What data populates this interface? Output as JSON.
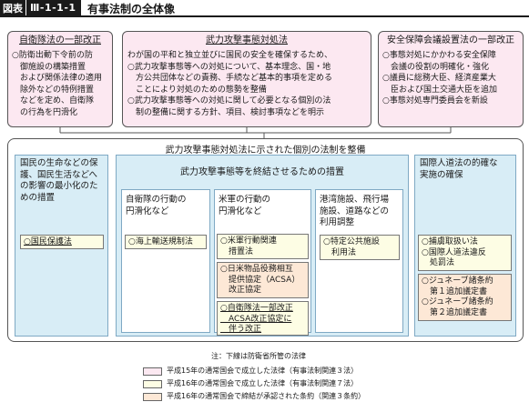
{
  "header": {
    "tag": "図表",
    "number": "Ⅲ-1-1-1",
    "title": "有事法制の全体像"
  },
  "top_boxes": [
    {
      "title": "自衛隊法の一部改正",
      "lines": [
        "○防衛出動下令前の防",
        "　御施設の構築措置",
        "　および関係法律の適用",
        "　除外などの特例措置",
        "　などを定め、自衛隊",
        "　の行為を円滑化"
      ]
    },
    {
      "title": "武力攻撃事態対処法",
      "lines": [
        "わが国の平和と独立並びに国民の安全を確保するため、",
        "○武力攻撃事態等への対処について、基本理念、国・地",
        "　方公共団体などの責務、手続など基本的事項を定める",
        "　ことにより対処のための態勢を整備",
        "○武力攻撃事態等への対処に関して必要となる個別の法",
        "　制の整備に関する方針、項目、検討事項などを明示"
      ]
    },
    {
      "title": "安全保障会議設置法の一部改正",
      "lines": [
        "○事態対処にかかわる安全保障",
        "　会議の役割の明確化・強化",
        "○議員に総務大臣、経済産業大",
        "　臣および国土交通大臣を追加",
        "○事態対処専門委員会を新設"
      ]
    }
  ],
  "main_title": "武力攻撃事態対処法に示された個別の法制を整備",
  "left_col": {
    "title_lines": [
      "国民の生命などの保",
      "護、国民生活などへ",
      "の影響の最小化のた",
      "めの措置"
    ],
    "law": "○国民保護法"
  },
  "center_header": "武力攻撃事態等を終結させるための措置",
  "center_cols": [
    {
      "title_lines": [
        "自衛隊の行動の",
        "円滑化など"
      ],
      "laws": [
        {
          "text": "○海上輸送規制法",
          "kind": "law-16"
        }
      ]
    },
    {
      "title_lines": [
        "米軍の行動の",
        "円滑化など"
      ],
      "laws": [
        {
          "text": "○米軍行動関連\n　措置法",
          "kind": "law-16"
        },
        {
          "text": "○日米物品役務相互\n　提供協定（ACSA）\n　改正協定",
          "kind": "treaty"
        },
        {
          "text": "○自衛隊法一部改正\n　ACSA改正協定に\n　伴う改正",
          "kind": "law-16"
        }
      ]
    },
    {
      "title_lines": [
        "港湾施設、飛行場",
        "施設、道路などの",
        "利用調整"
      ],
      "laws": [
        {
          "text": "○特定公共施設\n　利用法",
          "kind": "law-16"
        }
      ]
    }
  ],
  "right_col": {
    "title_lines": [
      "国際人道法の的確な",
      "実施の確保"
    ],
    "laws": [
      {
        "text": "○捕虜取扱い法\n○国際人道法違反\n　処罰法",
        "kind": "law-16"
      },
      {
        "text": "○ジュネーブ諸条約\n　第１追加議定書\n○ジュネーブ諸条約\n　第２追加議定書",
        "kind": "treaty"
      }
    ]
  },
  "note": "注：下線は防衛省所管の法律",
  "legend": [
    {
      "text": "平成15年の通常国会で成立した法律（有事法制関連３法）",
      "color": "#fce8f1"
    },
    {
      "text": "平成16年の通常国会で成立した法律（有事法制関連７法）",
      "color": "#fdfde4"
    },
    {
      "text": "平成16年の通常国会で締結が承認された条約（関連３条約）",
      "color": "#fde8d6"
    }
  ]
}
